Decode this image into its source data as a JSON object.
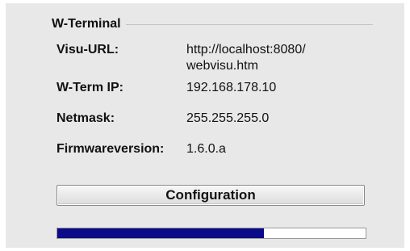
{
  "group": {
    "title": "W-Terminal"
  },
  "info": {
    "visu_url_label": "Visu-URL:",
    "visu_url_value": "http://localhost:8080/\nwebvisu.htm",
    "ip_label": "W-Term IP:",
    "ip_value": "192.168.178.10",
    "netmask_label": "Netmask:",
    "netmask_value": "255.255.255.0",
    "firmware_label": "Firmwareversion:",
    "firmware_value": "1.6.0.a"
  },
  "actions": {
    "configuration_label": "Configuration"
  },
  "progress": {
    "value_percent": 67,
    "fill_color": "#0b0b87"
  }
}
